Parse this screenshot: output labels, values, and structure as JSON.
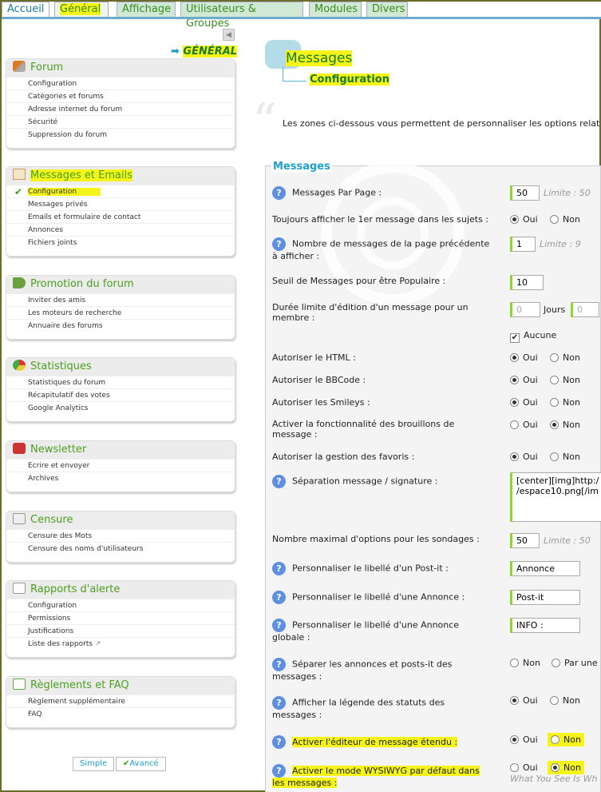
{
  "tabs": [
    "Accueil",
    "Général",
    "Affichage",
    "Utilisateurs & Groupes",
    "Modules",
    "Divers"
  ],
  "sidebar": {
    "header": "GÉNÉRAL",
    "boxes": [
      {
        "title": "Forum",
        "icon": "tools-icon",
        "items": [
          "Configuration",
          "Catégories et forums",
          "Adresse internet du forum",
          "Sécurité",
          "Suppression du forum"
        ]
      },
      {
        "title": "Messages et Emails",
        "icon": "document-icon",
        "items": [
          "Configuration",
          "Messages privés",
          "Emails et formulaire de contact",
          "Annonces",
          "Fichiers joints"
        ]
      },
      {
        "title": "Promotion du forum",
        "icon": "megaphone-icon",
        "items": [
          "Inviter des amis",
          "Les moteurs de recherche",
          "Annuaire des forums"
        ]
      },
      {
        "title": "Statistiques",
        "icon": "pie-chart-icon",
        "items": [
          "Statistiques du forum",
          "Récapitulatif des votes",
          "Google Analytics"
        ]
      },
      {
        "title": "Newsletter",
        "icon": "newsletter-icon",
        "items": [
          "Ecrire et envoyer",
          "Archives"
        ]
      },
      {
        "title": "Censure",
        "icon": "censure-icon",
        "items": [
          "Censure des Mots",
          "Censure des noms d'utilisateurs"
        ]
      },
      {
        "title": "Rapports d'alerte",
        "icon": "report-icon",
        "items": [
          "Configuration",
          "Permissions",
          "Justifications",
          "Liste des rapports"
        ]
      },
      {
        "title": "Règlements et FAQ",
        "icon": "rules-icon",
        "items": [
          "Règlement supplémentaire",
          "FAQ"
        ]
      }
    ],
    "buttons": {
      "simple": "Simple",
      "advanced": "Avancé"
    }
  },
  "main": {
    "title": "Messages",
    "subtitle": "Configuration",
    "intro": "Les zones ci-dessous vous permettent de personnaliser les options relat",
    "panel_title": "Messages",
    "labels": {
      "per_page": "Messages Par Page :",
      "first_msg": "Toujours afficher le 1er message dans les sujets :",
      "prev_page_1": "Nombre de messages de la page précédente",
      "prev_page_2": "à afficher :",
      "popular": "Seuil de Messages pour être Populaire :",
      "edit_limit_1": "Durée limite d'édition d'un message pour un",
      "edit_limit_2": "membre :",
      "html": "Autoriser le HTML :",
      "bbcode": "Autoriser le BBCode :",
      "smileys": "Autoriser les Smileys :",
      "drafts_1": "Activer la fonctionnalité des brouillons de",
      "drafts_2": "message :",
      "favs": "Autoriser la gestion des favoris :",
      "sig": "Séparation message / signature :",
      "poll": "Nombre maximal d'options pour les sondages :",
      "postit": "Personnaliser le libellé d'un Post-it :",
      "annonce": "Personnaliser le libellé d'une Annonce :",
      "annonce_glob_1": "Personnaliser le libellé d'une Annonce",
      "annonce_glob_2": "globale :",
      "separate_1": "Séparer les annonces et posts-it des",
      "separate_2": "messages :",
      "legend_1": "Afficher la légende des statuts des",
      "legend_2": "messages :",
      "editor": "Activer l'éditeur de message étendu :",
      "wysiwyg_1": "Activer le mode WYSIWYG par défaut dans",
      "wysiwyg_2": "les messages :"
    },
    "values": {
      "per_page": "50",
      "per_page_limit": "Limite : 50",
      "prev_page": "1",
      "prev_page_limit": "Limite : 9",
      "popular": "10",
      "edit_days": "0",
      "edit_days_unit": "Jours",
      "edit_hours": "0",
      "none": "Aucune",
      "sig_1": "[center][img]http:/",
      "sig_2": "/espace10.png[/im",
      "poll": "50",
      "poll_limit": "Limite : 50",
      "postit": "Annonce",
      "annonce": "Post-it",
      "annonce_glob": "INFO :",
      "yes": "Oui",
      "no": "Non",
      "by_one": "Par une",
      "wysiwyg_hint": "What You See Is Wh"
    }
  }
}
